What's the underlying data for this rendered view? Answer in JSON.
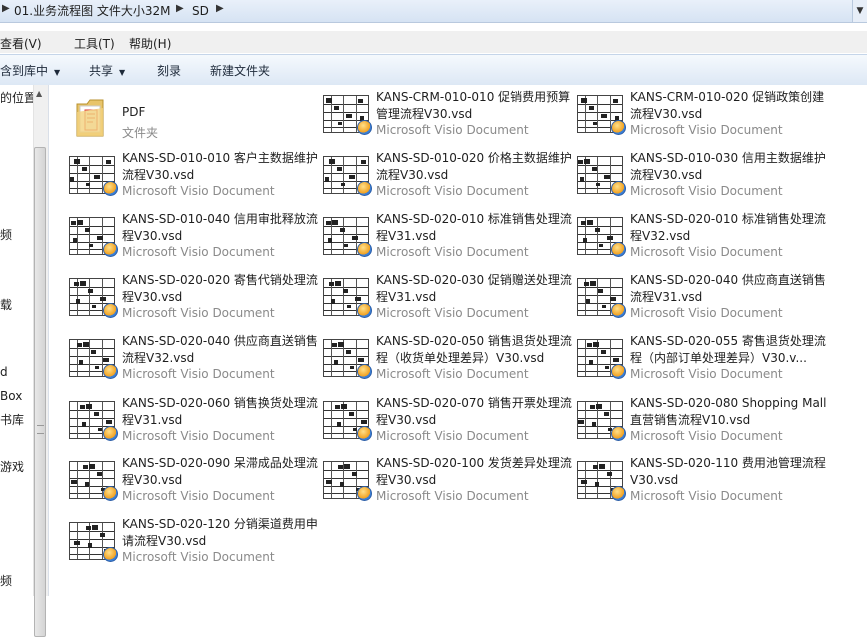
{
  "address": {
    "crumbs": [
      "01.业务流程图 文件大小32M",
      "SD"
    ]
  },
  "menu": {
    "view": "查看(V)",
    "tools": "工具(T)",
    "help": "帮助(H)"
  },
  "toolbar": {
    "include_library": "含到库中",
    "share": "共享",
    "burn": "刻录",
    "new_folder": "新建文件夹"
  },
  "nav": {
    "items": [
      "的位置",
      "频",
      "载",
      "d",
      "Box",
      "书库",
      "游戏",
      "频"
    ]
  },
  "folder": {
    "name": "PDF",
    "type": "文件夹"
  },
  "files": [
    {
      "name": "KANS-CRM-010-010 促销费用预算管理流程V30.vsd",
      "type": "Microsoft Visio Document"
    },
    {
      "name": "KANS-CRM-010-020 促销政策创建流程V30.vsd",
      "type": "Microsoft Visio Document"
    },
    {
      "name": "KANS-SD-010-010 客户主数据维护流程V30.vsd",
      "type": "Microsoft Visio Document"
    },
    {
      "name": "KANS-SD-010-020 价格主数据维护流程V30.vsd",
      "type": "Microsoft Visio Document"
    },
    {
      "name": "KANS-SD-010-030 信用主数据维护流程V30.vsd",
      "type": "Microsoft Visio Document"
    },
    {
      "name": "KANS-SD-010-040 信用审批释放流程V30.vsd",
      "type": "Microsoft Visio Document"
    },
    {
      "name": "KANS-SD-020-010 标准销售处理流程V31.vsd",
      "type": "Microsoft Visio Document"
    },
    {
      "name": "KANS-SD-020-010 标准销售处理流程V32.vsd",
      "type": "Microsoft Visio Document"
    },
    {
      "name": "KANS-SD-020-020 寄售代销处理流程V30.vsd",
      "type": "Microsoft Visio Document"
    },
    {
      "name": "KANS-SD-020-030 促销赠送处理流程V31.vsd",
      "type": "Microsoft Visio Document"
    },
    {
      "name": "KANS-SD-020-040 供应商直送销售流程V31.vsd",
      "type": "Microsoft Visio Document"
    },
    {
      "name": "KANS-SD-020-040 供应商直送销售流程V32.vsd",
      "type": "Microsoft Visio Document"
    },
    {
      "name": "KANS-SD-020-050 销售退货处理流程（收货单处理差异）V30.vsd",
      "type": "Microsoft Visio Document"
    },
    {
      "name": "KANS-SD-020-055 寄售退货处理流程（内部订单处理差异）V30.v...",
      "type": "Microsoft Visio Document"
    },
    {
      "name": "KANS-SD-020-060 销售换货处理流程V31.vsd",
      "type": "Microsoft Visio Document"
    },
    {
      "name": "KANS-SD-020-070 销售开票处理流程V30.vsd",
      "type": "Microsoft Visio Document"
    },
    {
      "name": "KANS-SD-020-080 Shopping Mall直营销售流程V10.vsd",
      "type": "Microsoft Visio Document"
    },
    {
      "name": "KANS-SD-020-090 呆滞成品处理流程V30.vsd",
      "type": "Microsoft Visio Document"
    },
    {
      "name": "KANS-SD-020-100 发货差异处理流程V30.vsd",
      "type": "Microsoft Visio Document"
    },
    {
      "name": "KANS-SD-020-110 费用池管理流程V30.vsd",
      "type": "Microsoft Visio Document"
    },
    {
      "name": "KANS-SD-020-120 分销渠道费用申请流程V30.vsd",
      "type": "Microsoft Visio Document"
    }
  ]
}
